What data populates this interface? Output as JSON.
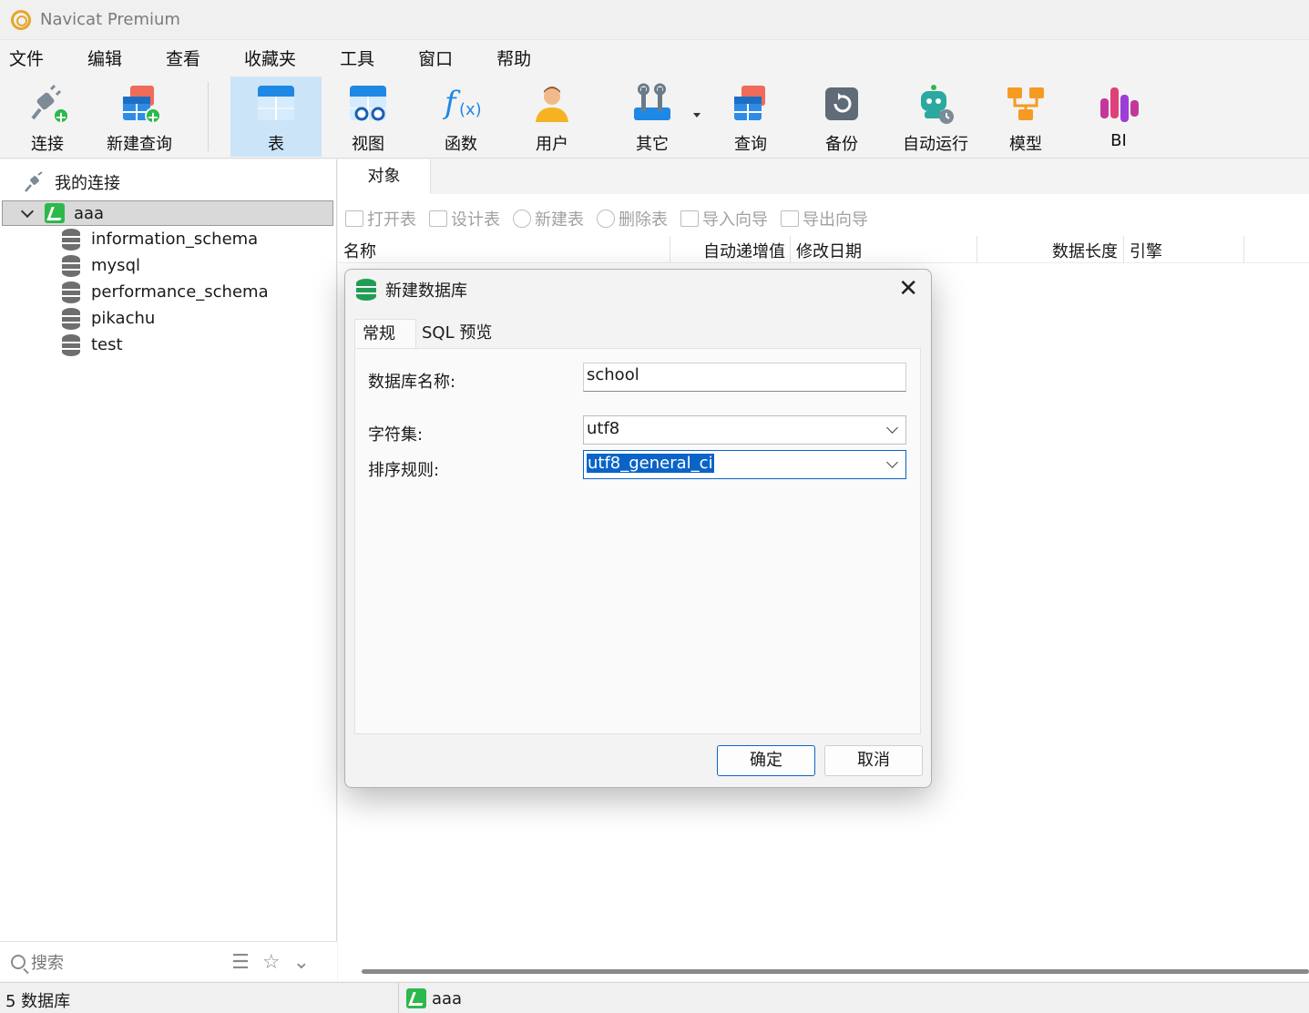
{
  "window": {
    "title": "Navicat Premium"
  },
  "menu": [
    "文件",
    "编辑",
    "查看",
    "收藏夹",
    "工具",
    "窗口",
    "帮助"
  ],
  "toolbar": {
    "connect": "连接",
    "new_query": "新建查询",
    "table": "表",
    "view": "视图",
    "function": "函数",
    "user": "用户",
    "other": "其它",
    "query": "查询",
    "backup": "备份",
    "automation": "自动运行",
    "model": "模型",
    "bi": "BI"
  },
  "sidebar": {
    "root_label": "我的连接",
    "connection": "aaa",
    "databases": [
      "information_schema",
      "mysql",
      "performance_schema",
      "pikachu",
      "test"
    ],
    "search_placeholder": "搜索"
  },
  "main": {
    "tab": "对象",
    "object_tools": [
      "打开表",
      "设计表",
      "新建表",
      "删除表",
      "导入向导",
      "导出向导"
    ],
    "columns": [
      "名称",
      "自动递增值",
      "修改日期",
      "数据长度",
      "引擎"
    ]
  },
  "dialog": {
    "title": "新建数据库",
    "tabs": [
      "常规",
      "SQL 预览"
    ],
    "db_name_label": "数据库名称:",
    "db_name_value": "school",
    "charset_label": "字符集:",
    "charset_value": "utf8",
    "collation_label": "排序规则:",
    "collation_value": "utf8_general_ci",
    "ok": "确定",
    "cancel": "取消"
  },
  "status": {
    "db_count": "5 数据库",
    "connection": "aaa"
  },
  "colors": {
    "accent": "#0a64c8",
    "active_tool": "#cce4f7",
    "mysql_green": "#2db84b"
  }
}
